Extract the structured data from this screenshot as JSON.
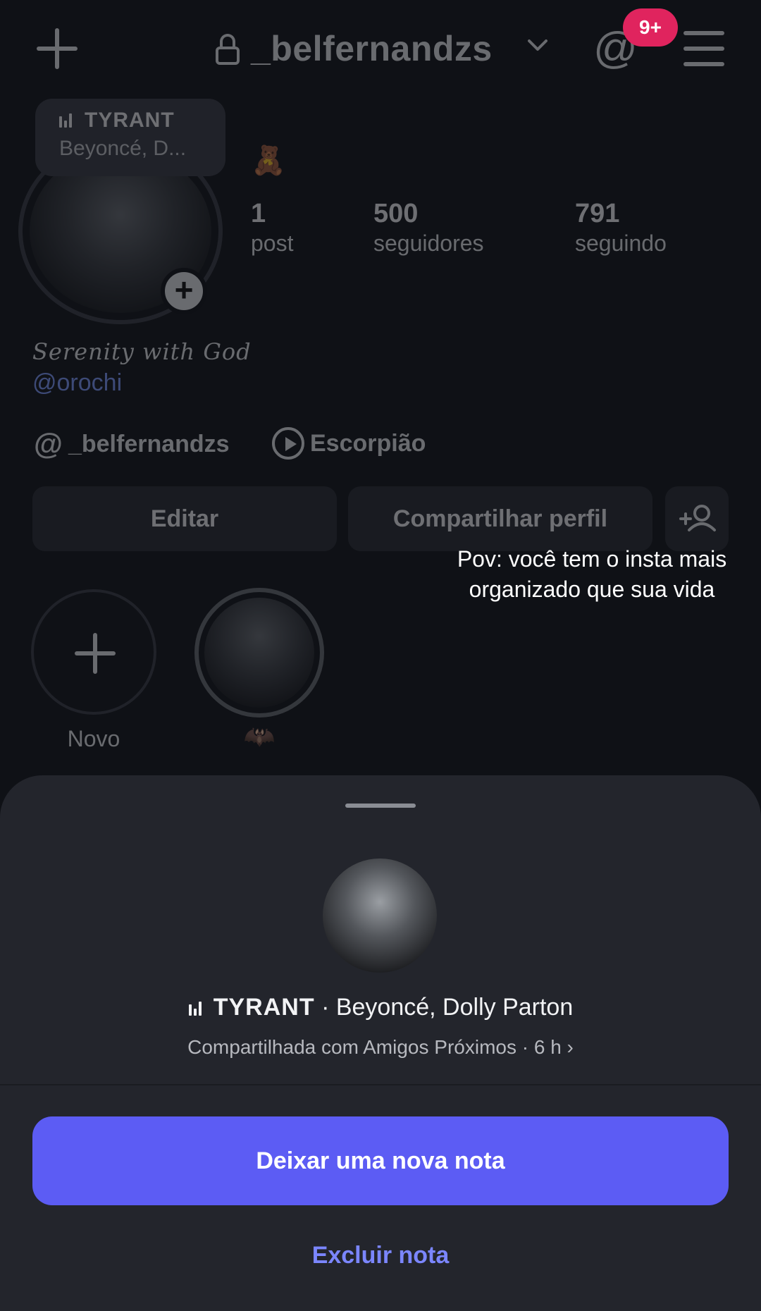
{
  "header": {
    "username": "_belfernandzs",
    "badge": "9+"
  },
  "profile": {
    "note": {
      "title": "TYRANT",
      "artist": "Beyoncé, D..."
    },
    "emoji": "🧸",
    "stats": [
      {
        "value": "1",
        "label": "post"
      },
      {
        "value": "500",
        "label": "seguidores"
      },
      {
        "value": "791",
        "label": "seguindo"
      }
    ],
    "bio": "Serenity with God",
    "mention": "@orochi",
    "threads_handle": "_belfernandzs",
    "zodiac": "Escorpião"
  },
  "actions": {
    "edit": "Editar",
    "share": "Compartilhar perfil"
  },
  "overlay_caption": "Pov: você tem o insta mais organizado que sua vida",
  "highlights": [
    {
      "label": "Novo"
    },
    {
      "label": "🦇"
    }
  ],
  "sheet": {
    "song_title": "TYRANT",
    "song_rest": " · Beyoncé, Dolly Parton",
    "shared_info": "Compartilhada com Amigos Próximos · 6 h ›",
    "primary_button": "Deixar uma nova nota",
    "delete_link": "Excluir nota"
  },
  "colors": {
    "accent": "#5c5cf4",
    "badge": "#e0245e",
    "link": "#7f9bff"
  }
}
